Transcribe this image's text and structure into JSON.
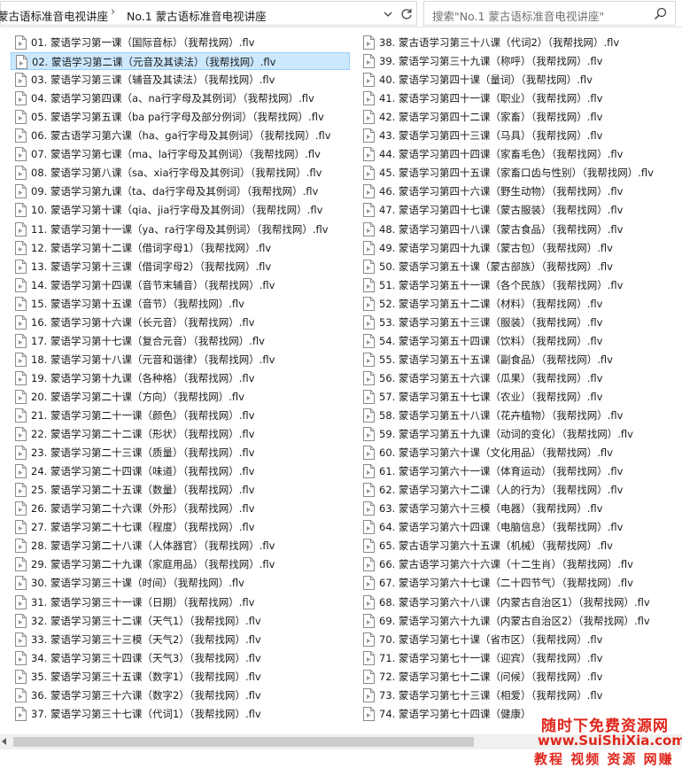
{
  "address_bar": {
    "crumbs": [
      "蒙古语标准音电视讲座",
      "No.1 蒙古语标准音电视讲座"
    ],
    "separator": "›"
  },
  "search": {
    "placeholder": "搜索\"No.1 蒙古语标准音电视讲座\""
  },
  "files": [
    {
      "name": "01. 蒙语学习第一课（国际音标）（我帮找网）.flv"
    },
    {
      "name": "02. 蒙语学习第二课（元音及其读法）（我帮找网）.flv",
      "selected": true
    },
    {
      "name": "03. 蒙语学习第三课（辅音及其读法）（我帮找网）.flv"
    },
    {
      "name": "04. 蒙语学习第四课（a、na行字母及其例词）（我帮找网）.flv"
    },
    {
      "name": "05. 蒙语学习第五课（ba pa行字母及部分例词）（我帮找网）.flv"
    },
    {
      "name": "06. 蒙古语学习第六课（ha、ga行字母及其例词）（我帮找网）.flv"
    },
    {
      "name": "07. 蒙语学习第七课（ma、la行字母及其例词）（我帮找网）.flv"
    },
    {
      "name": "08. 蒙语学习第八课（sa、xia行字母及其例词）（我帮找网）.flv"
    },
    {
      "name": "09. 蒙语学习第九课（ta、da行字母及其例词）（我帮找网）.flv"
    },
    {
      "name": "10. 蒙语学习第十课（qia、jia行字母及其例词）（我帮找网）.flv"
    },
    {
      "name": "11. 蒙语学习第十一课（ya、ra行字母及其例词）（我帮找网）.flv"
    },
    {
      "name": "12. 蒙语学习第十二课（借词字母1）（我帮找网）.flv"
    },
    {
      "name": "13. 蒙语学习第十三课（借词字母2）（我帮找网）.flv"
    },
    {
      "name": "14. 蒙语学习第十四课（音节末辅音）（我帮找网）.flv"
    },
    {
      "name": "15. 蒙语学习第十五课（音节）（我帮找网）.flv"
    },
    {
      "name": "16. 蒙语学习第十六课（长元音）（我帮找网）.flv"
    },
    {
      "name": "17. 蒙语学习第十七课（复合元音）（我帮找网）.flv"
    },
    {
      "name": "18. 蒙语学习第十八课（元音和谐律）（我帮找网）.flv"
    },
    {
      "name": "19. 蒙语学习第十九课（各种格）（我帮找网）.flv"
    },
    {
      "name": "20. 蒙语学习第二十课（方向）（我帮找网）.flv"
    },
    {
      "name": "21. 蒙语学习第二十一课（颜色）（我帮找网）.flv"
    },
    {
      "name": "22. 蒙语学习第二十二课（形状）（我帮找网）.flv"
    },
    {
      "name": "23. 蒙语学习第二十三课（质量）（我帮找网）.flv"
    },
    {
      "name": "24. 蒙语学习第二十四课（味道）（我帮找网）.flv"
    },
    {
      "name": "25. 蒙语学习第二十五课（数量）（我帮找网）.flv"
    },
    {
      "name": "26. 蒙语学习第二十六课（外形）（我帮找网）.flv"
    },
    {
      "name": "27. 蒙语学习第二十七课（程度）（我帮找网）.flv"
    },
    {
      "name": "28. 蒙语学习第二十八课（人体器官）（我帮找网）.flv"
    },
    {
      "name": "29. 蒙语学习第二十九课（家庭用品）（我帮找网）.flv"
    },
    {
      "name": "30. 蒙语学习第三十课（时间）（我帮找网）.flv"
    },
    {
      "name": "31. 蒙语学习第三十一课（日期）（我帮找网）.flv"
    },
    {
      "name": "32. 蒙语学习第三十二课（天气1）（我帮找网）.flv"
    },
    {
      "name": "33. 蒙语学习第三十三模（天气2）（我帮找网）.flv"
    },
    {
      "name": "34. 蒙语学习第三十四课（天气3）（我帮找网）.flv"
    },
    {
      "name": "35. 蒙语学习第三十五课（数字1）（我帮找网）.flv"
    },
    {
      "name": "36. 蒙语学习第三十六课（数字2）（我帮找网）.flv"
    },
    {
      "name": "37. 蒙语学习第三十七课（代词1）（我帮找网）.flv"
    },
    {
      "name": "38. 蒙古语学习第三十八课（代词2）（我帮找网）.flv"
    },
    {
      "name": "39. 蒙语学习第三十九课（称呼）（我帮找网）.flv"
    },
    {
      "name": "40. 蒙语学习第四十课（量词）（我帮找网）.flv"
    },
    {
      "name": "41. 蒙语学习第四十一课（职业）（我帮找网）.flv"
    },
    {
      "name": "42. 蒙语学习第四十二课（家畜）（我帮找网）.flv"
    },
    {
      "name": "43. 蒙语学习第四十三课（马具）（我帮找网）.flv"
    },
    {
      "name": "44. 蒙语学习第四十四课（家畜毛色）（我帮找网）.flv"
    },
    {
      "name": "45. 蒙语学习第四十五课（家畜口齿与性别）（我帮找网）.flv"
    },
    {
      "name": "46. 蒙语学习第四十六课（野生动物）（我帮找网）.flv"
    },
    {
      "name": "47. 蒙语学习第四十七课（蒙古服装）（我帮找网）.flv"
    },
    {
      "name": "48. 蒙语学习第四十八课（蒙古食品）（我帮找网）.flv"
    },
    {
      "name": "49. 蒙语学习第四十九课（蒙古包）（我帮找网）.flv"
    },
    {
      "name": "50. 蒙语学习第五十课（蒙古部族）（我帮找网）.flv"
    },
    {
      "name": "51. 蒙语学习第五十一课（各个民族）（我帮找网）.flv"
    },
    {
      "name": "52. 蒙语学习第五十二课（材料）（我帮找网）.flv"
    },
    {
      "name": "53. 蒙语学习第五十三课（服装）（我帮找网）.flv"
    },
    {
      "name": "54. 蒙语学习第五十四课（饮料）（我帮找网）.flv"
    },
    {
      "name": "55. 蒙语学习第五十五课（副食品）（我帮找网）.flv"
    },
    {
      "name": "56. 蒙语学习第五十六课（瓜果）（我帮找网）.flv"
    },
    {
      "name": "57. 蒙语学习第五十七课（农业）（我帮找网）.flv"
    },
    {
      "name": "58. 蒙语学习第五十八课（花卉植物）（我帮找网）.flv"
    },
    {
      "name": "59. 蒙语学习第五十九课（动词的变化）（我帮找网）.flv"
    },
    {
      "name": "60. 蒙语学习第六十课（文化用品）（我帮找网）.flv"
    },
    {
      "name": "61. 蒙语学习第六十一课（体育运动）（我帮找网）.flv"
    },
    {
      "name": "62. 蒙语学习第六十二课（人的行为）（我帮找网）.flv"
    },
    {
      "name": "63. 蒙语学习第六十三模（电器）（我帮找网）.flv"
    },
    {
      "name": "64. 蒙语学习第六十四课（电脑信息）（我帮找网）.flv"
    },
    {
      "name": "65. 蒙古语学习第六十五课（机械）（我帮找网）.flv"
    },
    {
      "name": "66. 蒙古语学习第六十六课（十二生肖）（我帮找网）.flv"
    },
    {
      "name": "67. 蒙语学习第六十七课（二十四节气）（我帮找网）.flv"
    },
    {
      "name": "68. 蒙语学习第六十八课（内蒙古自治区1）（我帮找网）.flv"
    },
    {
      "name": "69. 蒙语学习第六十九课（内蒙古自治区2）（我帮找网）.flv"
    },
    {
      "name": "70. 蒙语学习第七十课（省市区）（我帮找网）.flv"
    },
    {
      "name": "71. 蒙语学习第七十一课（迎宾）（我帮找网）.flv"
    },
    {
      "name": "72. 蒙语学习第七十二课（问候）（我帮找网）.flv"
    },
    {
      "name": "73. 蒙语学习第七十三课（相爱）（我帮找网）.flv"
    },
    {
      "name": "74. 蒙语学习第七十四课（健康）"
    }
  ],
  "watermark": {
    "line1": "随时下免费资源网",
    "line2": "www.SuiShiXia.com",
    "line3": "教程 视频 资源 网赚"
  },
  "colors": {
    "selection_bg": "#cce8ff",
    "selection_border": "#99d1ff",
    "watermark": "#e0261c"
  }
}
